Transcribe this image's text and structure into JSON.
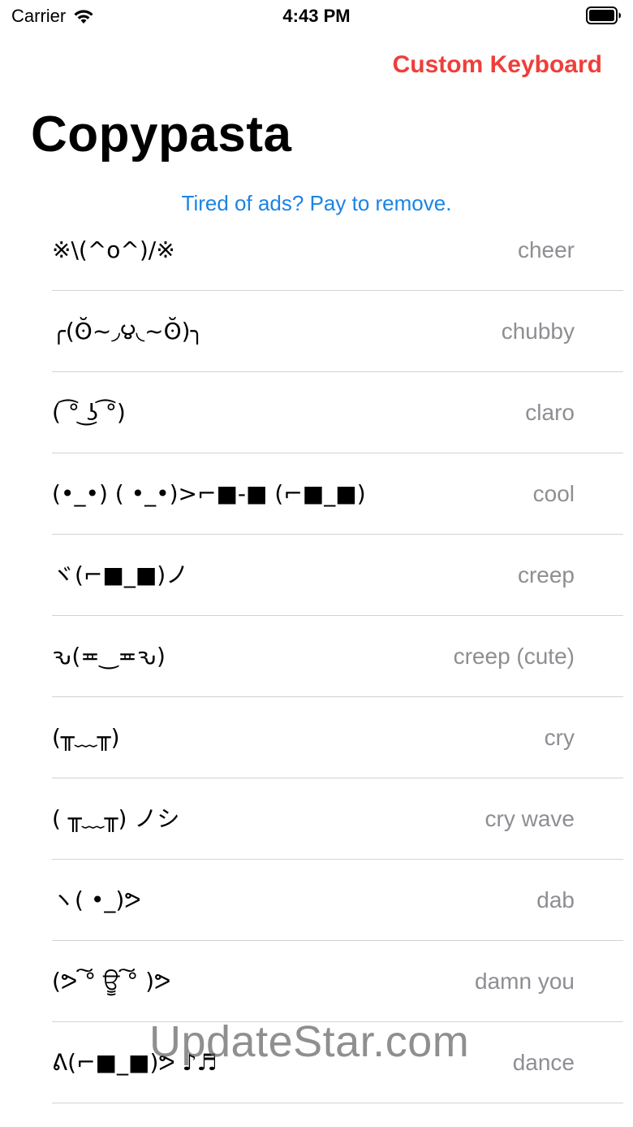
{
  "status_bar": {
    "carrier": "Carrier",
    "time": "4:43 PM",
    "wifi_icon": "wifi-icon",
    "battery_icon": "battery-icon"
  },
  "nav": {
    "action_label": "Custom Keyboard",
    "action_color": "#ee3f3a"
  },
  "page": {
    "title": "Copypasta"
  },
  "ads": {
    "label": "Tired of ads? Pay to remove.",
    "color": "#1a84e6"
  },
  "list": {
    "items": [
      {
        "emoticon": "※\\(^o^)/※",
        "label": "cheer"
      },
      {
        "emoticon": "╭(ʘ̆~◞౪◟~ʘ̆)╮",
        "label": "chubby"
      },
      {
        "emoticon": "( ͡° ͜ʖ ͡°)",
        "label": "claro"
      },
      {
        "emoticon": "(•_•) ( •_•)>⌐■-■ (⌐■_■)",
        "label": "cool"
      },
      {
        "emoticon": "ヾ(⌐■_■)ノ",
        "label": "creep"
      },
      {
        "emoticon": "ԅ(≖‿≖ԅ)",
        "label": "creep (cute)"
      },
      {
        "emoticon": "(╥﹏╥)",
        "label": "cry"
      },
      {
        "emoticon": "( ╥﹏╥) ノシ",
        "label": "cry wave"
      },
      {
        "emoticon": "ヽ( •_)ᕗ",
        "label": "dab"
      },
      {
        "emoticon": "(ᕗ ͠° ਊ ͠° )ᕗ",
        "label": "damn you"
      },
      {
        "emoticon": "ᕕ(⌐■_■)ᕗ ♪♬",
        "label": "dance"
      }
    ]
  },
  "watermark": {
    "text": "UpdateStar.com"
  }
}
